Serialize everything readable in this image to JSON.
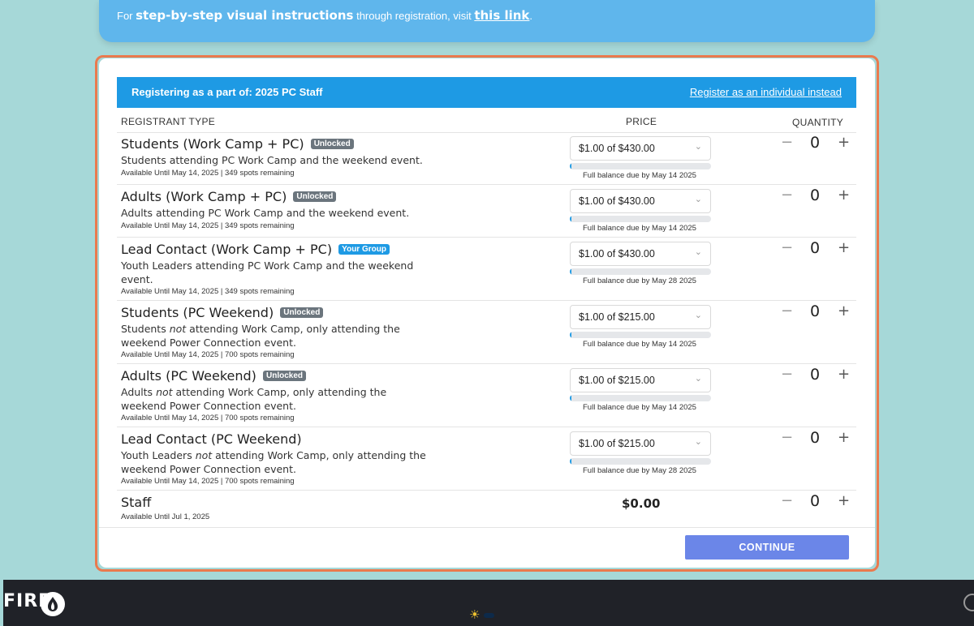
{
  "banner": {
    "prefix": "For ",
    "bold": "step-by-step visual instructions",
    "middle": " through registration, visit ",
    "link": "this link",
    "suffix": "."
  },
  "registering": {
    "label": "Registering as a part of: 2025 PC Staff",
    "individual_link": "Register as an individual instead"
  },
  "table_headers": {
    "type": "REGISTRANT TYPE",
    "price": "PRICE",
    "quantity": "QUANTITY"
  },
  "rows": [
    {
      "title": "Students (Work Camp + PC)",
      "badge": "Unlocked",
      "desc": "Students attending PC Work Camp and the weekend event.",
      "avail": "Available Until May 14, 2025 | 349 spots remaining",
      "price": "$1.00 of $430.00",
      "due": "Full balance due by May 14 2025",
      "qty": "0"
    },
    {
      "title": "Adults (Work Camp + PC)",
      "badge": "Unlocked",
      "desc": "Adults attending PC Work Camp and the weekend event.",
      "avail": "Available Until May 14, 2025 | 349 spots remaining",
      "price": "$1.00 of $430.00",
      "due": "Full balance due by May 14 2025",
      "qty": "0"
    },
    {
      "title": "Lead Contact (Work Camp + PC)",
      "badge": "Your Group",
      "desc": "Youth Leaders attending PC Work Camp and the weekend event.",
      "avail": "Available Until May 14, 2025 | 349 spots remaining",
      "price": "$1.00 of $430.00",
      "due": "Full balance due by May 28 2025",
      "qty": "0"
    },
    {
      "title": "Students (PC Weekend)",
      "badge": "Unlocked",
      "desc_pre": "Students ",
      "desc_em": "not",
      "desc_post": " attending Work Camp, only attending the weekend Power Connection event.",
      "avail": "Available Until May 14, 2025 | 700 spots remaining",
      "price": "$1.00 of $215.00",
      "due": "Full balance due by May 14 2025",
      "qty": "0"
    },
    {
      "title": "Adults (PC Weekend)",
      "badge": "Unlocked",
      "desc_pre": "Adults ",
      "desc_em": "not",
      "desc_post": " attending Work Camp, only attending the weekend Power Connection event.",
      "avail": "Available Until May 14, 2025 | 700 spots remaining",
      "price": "$1.00 of $215.00",
      "due": "Full balance due by May 14 2025",
      "qty": "0"
    },
    {
      "title": "Lead Contact (PC Weekend)",
      "desc_pre": "Youth Leaders ",
      "desc_em": "not",
      "desc_post": " attending Work Camp, only attending the weekend Power Connection event.",
      "avail": "Available Until May 14, 2025 | 700 spots remaining",
      "price": "$1.00 of $215.00",
      "due": "Full balance due by May 28 2025",
      "qty": "0"
    },
    {
      "title": "Staff",
      "avail": "Available Until Jul 1, 2025",
      "price": "$0.00",
      "qty": "0"
    }
  ],
  "qty_controls": {
    "minus": "−",
    "plus": "+"
  },
  "continue_label": "CONTINUE",
  "footer": {
    "logo_text": "FIRE"
  },
  "colors": {
    "accent": "#1e9ae4",
    "continue": "#6b86e8",
    "highlight": "#ea7a4e",
    "background": "#a6d8d8"
  }
}
